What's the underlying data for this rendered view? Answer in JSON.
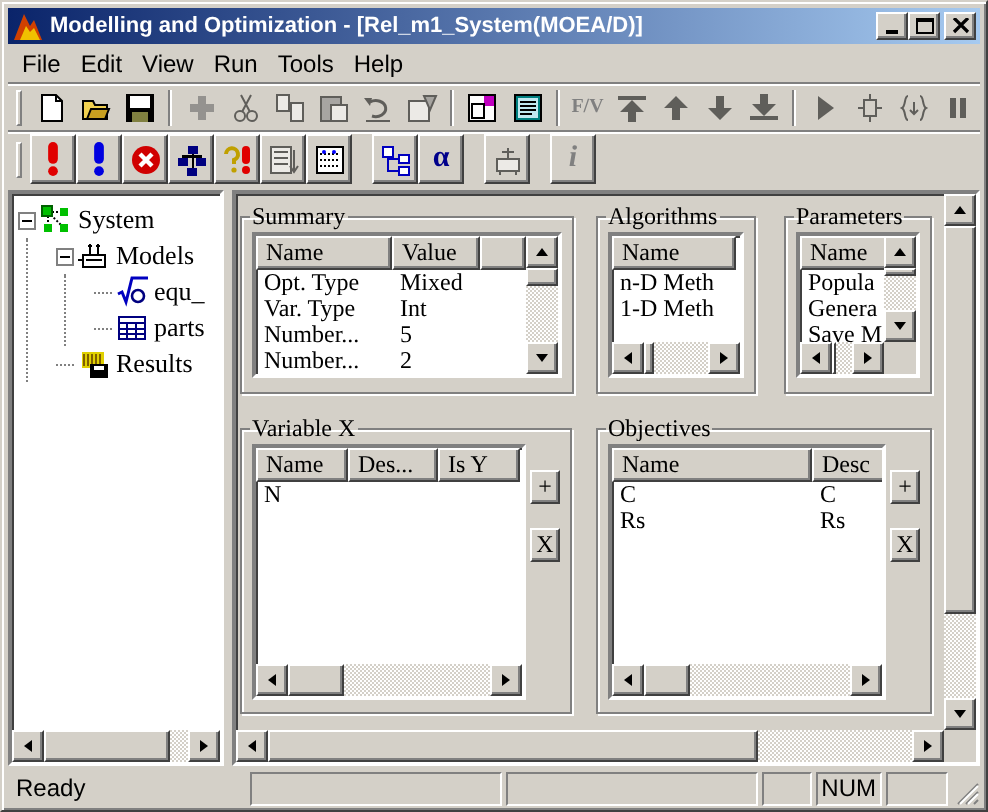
{
  "window": {
    "title": "Modelling and Optimization - [Rel_m1_System(MOEA/D)]",
    "controls": [
      {
        "kind": "minimize"
      },
      {
        "kind": "maximize"
      },
      {
        "kind": "close"
      }
    ]
  },
  "menu": [
    {
      "label": "File"
    },
    {
      "label": "Edit"
    },
    {
      "label": "View"
    },
    {
      "label": "Run"
    },
    {
      "label": "Tools"
    },
    {
      "label": "Help"
    }
  ],
  "toolbar_1": [
    {
      "kind": "new",
      "disabled": false
    },
    {
      "kind": "open",
      "disabled": false
    },
    {
      "kind": "save",
      "disabled": false
    },
    {
      "kind": "separator"
    },
    {
      "kind": "plus",
      "disabled": true
    },
    {
      "kind": "cut",
      "disabled": true
    },
    {
      "kind": "copy",
      "disabled": true
    },
    {
      "kind": "paste",
      "disabled": true
    },
    {
      "kind": "undo",
      "disabled": true
    },
    {
      "kind": "properties",
      "disabled": true
    },
    {
      "kind": "separator"
    },
    {
      "kind": "window",
      "disabled": false
    },
    {
      "kind": "panel",
      "disabled": false
    },
    {
      "kind": "separator"
    },
    {
      "kind": "text",
      "label": "F/V",
      "disabled": true
    },
    {
      "kind": "top",
      "disabled": true
    },
    {
      "kind": "up",
      "disabled": true
    },
    {
      "kind": "down",
      "disabled": true
    },
    {
      "kind": "bottom",
      "disabled": true
    },
    {
      "kind": "separator"
    },
    {
      "kind": "play",
      "disabled": true
    },
    {
      "kind": "step",
      "disabled": true
    },
    {
      "kind": "braces",
      "disabled": true
    },
    {
      "kind": "pause",
      "disabled": true
    }
  ],
  "toolbar_2": [
    {
      "kind": "alert_red",
      "disabled": false
    },
    {
      "kind": "alert_blue",
      "disabled": false
    },
    {
      "kind": "error",
      "disabled": false
    },
    {
      "kind": "network",
      "disabled": false
    },
    {
      "kind": "question",
      "disabled": false
    },
    {
      "kind": "list",
      "disabled": true
    },
    {
      "kind": "grid",
      "disabled": false
    },
    {
      "kind": "separator"
    },
    {
      "kind": "tree",
      "disabled": false
    },
    {
      "kind": "text",
      "label": "α",
      "disabled": false
    },
    {
      "kind": "separator"
    },
    {
      "kind": "device",
      "disabled": true
    },
    {
      "kind": "separator"
    },
    {
      "kind": "text",
      "label": "i",
      "disabled": true
    }
  ],
  "tree": [
    {
      "label": "System",
      "kind": "system",
      "expanded": true,
      "children": [
        {
          "label": "Models",
          "kind": "models",
          "expanded": true,
          "children": [
            {
              "label": "equ_",
              "kind": "equation"
            },
            {
              "label": "parts",
              "kind": "table"
            }
          ]
        },
        {
          "label": "Results",
          "kind": "results"
        }
      ]
    }
  ],
  "groups": [
    {
      "title": "Summary",
      "columns": [
        "Name",
        "Value"
      ],
      "rows": [
        [
          "Opt. Type",
          "Mixed"
        ],
        [
          "Var. Type",
          "Int"
        ],
        [
          "Number...",
          "5"
        ],
        [
          "Number...",
          "2"
        ]
      ]
    },
    {
      "title": "Algorithms",
      "columns": [
        "Name"
      ],
      "rows": [
        [
          "n-D Meth"
        ],
        [
          "1-D Meth"
        ]
      ]
    },
    {
      "title": "Parameters",
      "columns": [
        "Name"
      ],
      "rows": [
        [
          "Popula"
        ],
        [
          "Genera"
        ],
        [
          "Save M"
        ]
      ]
    },
    {
      "title": "Variable X",
      "columns": [
        "Name",
        "Des...",
        "Is Y"
      ],
      "rows": [
        [
          "N"
        ]
      ],
      "buttons": [
        "+",
        "X"
      ]
    },
    {
      "title": "Objectives",
      "columns": [
        "Name",
        "Desc"
      ],
      "rows": [
        [
          "C",
          "C"
        ],
        [
          "Rs",
          "Rs"
        ]
      ],
      "buttons": [
        "+",
        "X"
      ]
    }
  ],
  "status_bar": {
    "text": "Ready",
    "indicators": [
      "NUM"
    ]
  }
}
